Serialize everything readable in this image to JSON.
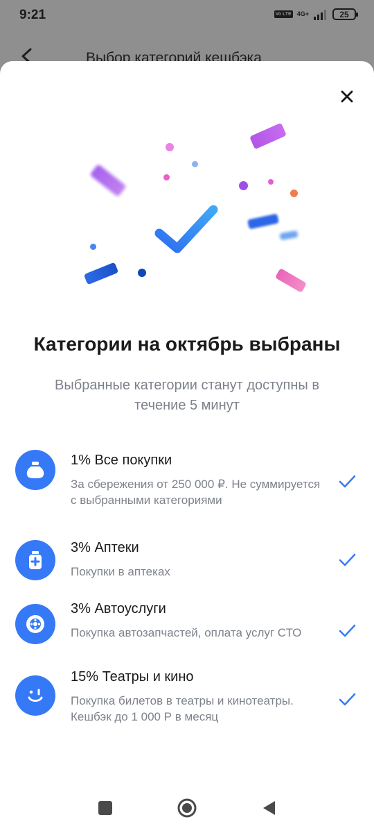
{
  "status_bar": {
    "time": "9:21",
    "volte": "Vo LTE",
    "network": "4G+",
    "battery": "25"
  },
  "header": {
    "title": "Выбор категорий кешбэка"
  },
  "sheet": {
    "title": "Категории на октябрь выбраны",
    "subtitle": "Выбранные категории станут доступны в течение 5 минут",
    "accent_color": "#3579f6",
    "items": [
      {
        "title": "1% Все покупки",
        "desc": "За сбережения от 250 000 ₽. Не суммируется с выбранными категориями",
        "icon": "money-bag-icon"
      },
      {
        "title": "3% Аптеки",
        "desc": "Покупки в аптеках",
        "icon": "medicine-bottle-icon"
      },
      {
        "title": "3% Автоуслуги",
        "desc": "Покупка автозапчастей, оплата услуг СТО",
        "icon": "car-wheel-icon"
      },
      {
        "title": "15% Театры и кино",
        "desc": "Покупка билетов в театры и кинотеатры. Кешбэк до 1 000 Р в месяц",
        "icon": "smiley-face-icon"
      }
    ]
  }
}
